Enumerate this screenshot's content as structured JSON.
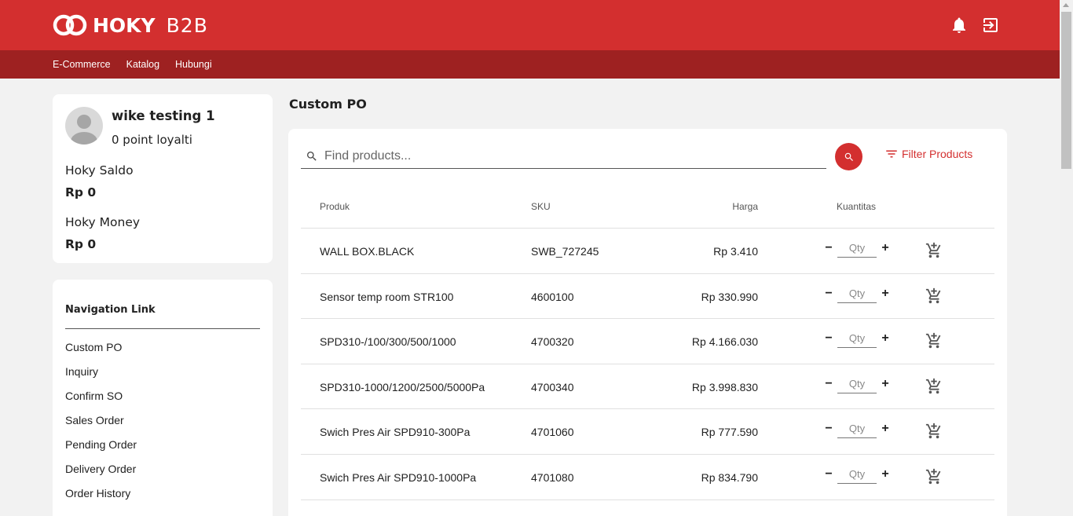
{
  "brand": {
    "name": "HOKY",
    "suffix": "B2B"
  },
  "colors": {
    "primary": "#d32f2f",
    "primary_dark": "#9e2121",
    "background": "#f2f2f2"
  },
  "header_icons": [
    "bell-icon",
    "logout-icon"
  ],
  "subnav": [
    "E-Commerce",
    "Katalog",
    "Hubungi"
  ],
  "profile": {
    "name": "wike testing 1",
    "points": "0 point loyalti",
    "saldo_label": "Hoky Saldo",
    "saldo_value": "Rp 0",
    "money_label": "Hoky Money",
    "money_value": "Rp 0"
  },
  "nav": {
    "title": "Navigation Link",
    "items": [
      "Custom PO",
      "Inquiry",
      "Confirm SO",
      "Sales Order",
      "Pending Order",
      "Delivery Order",
      "Order History"
    ]
  },
  "page": {
    "title": "Custom PO"
  },
  "search": {
    "placeholder": "Find products...",
    "filter_label": "Filter Products"
  },
  "table": {
    "headers": {
      "product": "Produk",
      "sku": "SKU",
      "price": "Harga",
      "qty": "Kuantitas"
    },
    "qty_placeholder": "Qty",
    "rows": [
      {
        "product": "WALL BOX.BLACK",
        "sku": "SWB_727245",
        "price": "Rp 3.410"
      },
      {
        "product": "Sensor temp room STR100",
        "sku": "4600100",
        "price": "Rp 330.990"
      },
      {
        "product": "SPD310-/100/300/500/1000",
        "sku": "4700320",
        "price": "Rp 4.166.030"
      },
      {
        "product": "SPD310-1000/1200/2500/5000Pa",
        "sku": "4700340",
        "price": "Rp 3.998.830"
      },
      {
        "product": "Swich Pres Air SPD910-300Pa",
        "sku": "4701060",
        "price": "Rp 777.590"
      },
      {
        "product": "Swich Pres Air SPD910-1000Pa",
        "sku": "4701080",
        "price": "Rp 834.790"
      }
    ]
  }
}
